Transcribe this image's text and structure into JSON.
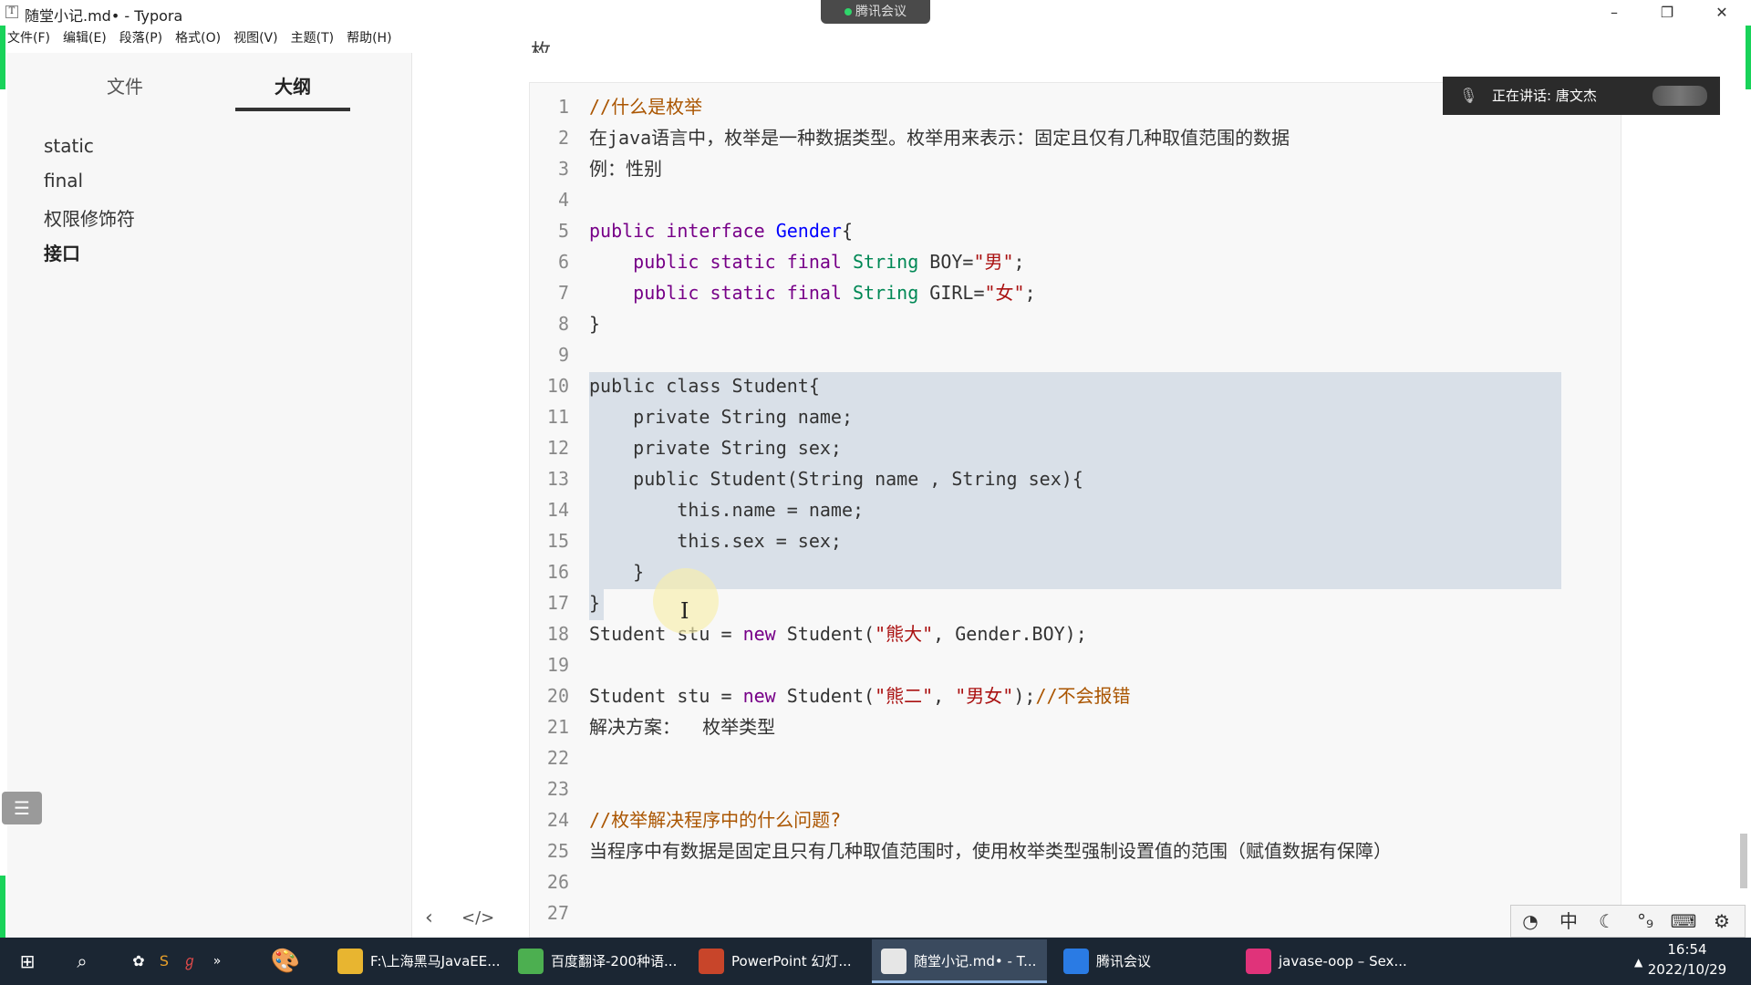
{
  "window": {
    "title": "随堂小记.md• - Typora",
    "app_icon_glyph": "T",
    "controls": {
      "minimize": "–",
      "restore": "❐",
      "close": "✕"
    }
  },
  "meeting_tab": {
    "label": "腾讯会议"
  },
  "menu": [
    "文件(F)",
    "编辑(E)",
    "段落(P)",
    "格式(O)",
    "视图(V)",
    "主题(T)",
    "帮助(H)"
  ],
  "sidebar": {
    "tabs": [
      "文件",
      "大纲"
    ],
    "active_tab": "大纲",
    "outline": [
      "static",
      "final",
      "权限修饰符",
      "接口"
    ],
    "active_outline": "接口",
    "toggle_glyph": "☰",
    "nav_prev_glyph": "‹",
    "source_toggle_glyph": "</>"
  },
  "editor": {
    "heading_fragment": "枚举",
    "lines": [
      {
        "n": "1",
        "spans": [
          {
            "t": "//什么是枚举",
            "c": "cm"
          }
        ]
      },
      {
        "n": "2",
        "spans": [
          {
            "t": "在java语言中，枚举是一种数据类型。枚举用来表示：固定且仅有几种取值范围的数据",
            "c": "tx"
          }
        ]
      },
      {
        "n": "3",
        "spans": [
          {
            "t": "例：性别",
            "c": "tx"
          }
        ]
      },
      {
        "n": "4",
        "spans": []
      },
      {
        "n": "5",
        "spans": [
          {
            "t": "public interface ",
            "c": "kw"
          },
          {
            "t": "Gender",
            "c": "df"
          },
          {
            "t": "{",
            "c": "tx"
          }
        ]
      },
      {
        "n": "6",
        "spans": [
          {
            "t": "    public static final ",
            "c": "kw"
          },
          {
            "t": "String",
            "c": "ty"
          },
          {
            "t": " BOY=",
            "c": "tx"
          },
          {
            "t": "\"男\"",
            "c": "st"
          },
          {
            "t": ";",
            "c": "tx"
          }
        ]
      },
      {
        "n": "7",
        "spans": [
          {
            "t": "    public static final ",
            "c": "kw"
          },
          {
            "t": "String",
            "c": "ty"
          },
          {
            "t": " GIRL=",
            "c": "tx"
          },
          {
            "t": "\"女\"",
            "c": "st"
          },
          {
            "t": ";",
            "c": "tx"
          }
        ]
      },
      {
        "n": "8",
        "spans": [
          {
            "t": "}",
            "c": "tx"
          }
        ]
      },
      {
        "n": "9",
        "spans": []
      },
      {
        "n": "10",
        "spans": [
          {
            "t": "public class Student{",
            "c": "tx"
          }
        ]
      },
      {
        "n": "11",
        "spans": [
          {
            "t": "    private String name;",
            "c": "tx"
          }
        ]
      },
      {
        "n": "12",
        "spans": [
          {
            "t": "    private String sex;",
            "c": "tx"
          }
        ]
      },
      {
        "n": "13",
        "spans": [
          {
            "t": "    public Student(String name , String sex){",
            "c": "tx"
          }
        ]
      },
      {
        "n": "14",
        "spans": [
          {
            "t": "        this.name = name;",
            "c": "tx"
          }
        ]
      },
      {
        "n": "15",
        "spans": [
          {
            "t": "        this.sex = sex;",
            "c": "tx"
          }
        ]
      },
      {
        "n": "16",
        "spans": [
          {
            "t": "    }",
            "c": "tx"
          }
        ]
      },
      {
        "n": "17",
        "spans": [
          {
            "t": "}",
            "c": "tx"
          }
        ]
      },
      {
        "n": "18",
        "spans": [
          {
            "t": "Student stu = ",
            "c": "tx"
          },
          {
            "t": "new",
            "c": "kw"
          },
          {
            "t": " Student(",
            "c": "tx"
          },
          {
            "t": "\"熊大\"",
            "c": "st"
          },
          {
            "t": ", Gender.BOY);",
            "c": "tx"
          }
        ]
      },
      {
        "n": "19",
        "spans": []
      },
      {
        "n": "20",
        "spans": [
          {
            "t": "Student stu = ",
            "c": "tx"
          },
          {
            "t": "new",
            "c": "kw"
          },
          {
            "t": " Student(",
            "c": "tx"
          },
          {
            "t": "\"熊二\"",
            "c": "st"
          },
          {
            "t": ", ",
            "c": "tx"
          },
          {
            "t": "\"男女\"",
            "c": "st"
          },
          {
            "t": ");",
            "c": "tx"
          },
          {
            "t": "//不会报错",
            "c": "cm"
          }
        ]
      },
      {
        "n": "21",
        "spans": [
          {
            "t": "解决方案：  枚举类型",
            "c": "tx"
          }
        ]
      },
      {
        "n": "22",
        "spans": []
      },
      {
        "n": "23",
        "spans": []
      },
      {
        "n": "24",
        "spans": [
          {
            "t": "//枚举解决程序中的什么问题?",
            "c": "cm"
          }
        ]
      },
      {
        "n": "25",
        "spans": [
          {
            "t": "当程序中有数据是固定且只有几种取值范围时，使用枚举类型强制设置值的范围（赋值数据有保障）",
            "c": "tx"
          }
        ]
      },
      {
        "n": "26",
        "spans": []
      },
      {
        "n": "27",
        "spans": []
      }
    ]
  },
  "speaking": {
    "text": "正在讲话: 唐文杰",
    "icon": "microphone-icon"
  },
  "ime": [
    "◔",
    "中",
    "☾",
    "°₉",
    "⌨",
    "⚙"
  ],
  "taskbar": {
    "tasks": [
      {
        "label": "F:\\上海黑马JavaEE...",
        "color": "#e8b530"
      },
      {
        "label": "百度翻译-200种语...",
        "color": "#4caf50"
      },
      {
        "label": "PowerPoint 幻灯...",
        "color": "#c8452a"
      },
      {
        "label": "随堂小记.md• - T...",
        "color": "#e6e6e6"
      },
      {
        "label": "腾讯会议",
        "color": "#2a7be4"
      },
      {
        "label": "javase-oop – Sex...",
        "color": "#e0337a"
      }
    ],
    "active_task": "随堂小记.md• - T...",
    "time": "16:54",
    "date": "2022/10/29"
  },
  "colors": {
    "share_border": "#19d35a",
    "selection": "#d9e0e8",
    "taskbar": "#1b2633"
  }
}
